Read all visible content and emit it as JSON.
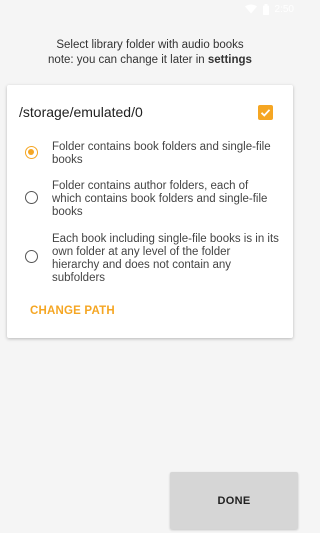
{
  "statusbar": {
    "time": "2:50",
    "icons": [
      "wifi-icon",
      "battery-icon"
    ]
  },
  "intro": {
    "line1": "Select library folder with audio books",
    "line2_prefix": "note: you can change it later in ",
    "line2_link": "settings"
  },
  "card": {
    "path": "/storage/emulated/0",
    "path_checked": true,
    "options": [
      {
        "label": "Folder contains book folders and single-file books",
        "selected": true
      },
      {
        "label": "Folder contains author folders, each of which contains book folders and single-file books",
        "selected": false
      },
      {
        "label": "Each book including single-file books is in its own folder at any level of the folder hierarchy and does not contain any subfolders",
        "selected": false
      }
    ],
    "change_path_label": "CHANGE PATH"
  },
  "done_label": "DONE",
  "colors": {
    "accent": "#f5a623",
    "background": "#f5f5f5",
    "button": "#d6d6d6"
  }
}
